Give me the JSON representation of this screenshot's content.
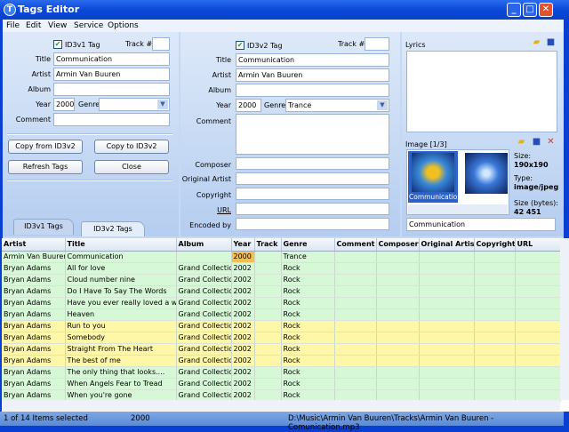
{
  "window": {
    "title": "Tags Editor"
  },
  "menu": [
    "File",
    "Edit",
    "View",
    "Service",
    "Options"
  ],
  "id3v1": {
    "enabled_label": "ID3v1 Tag",
    "track_label": "Track #",
    "track": "",
    "title_label": "Title",
    "title": "Communication",
    "artist_label": "Artist",
    "artist": "Armin Van Buuren",
    "album_label": "Album",
    "album": "",
    "year_label": "Year",
    "year": "2000",
    "genre_label": "Genre",
    "genre": "",
    "comment_label": "Comment",
    "comment": "",
    "buttons": {
      "copy_from": "Copy from ID3v2",
      "copy_to": "Copy to ID3v2",
      "refresh": "Refresh Tags",
      "close": "Close"
    }
  },
  "tabs": [
    {
      "label": "ID3v1 Tags",
      "active": false
    },
    {
      "label": "ID3v2 Tags",
      "active": true
    }
  ],
  "id3v2": {
    "enabled_label": "ID3v2 Tag",
    "track_label": "Track #",
    "track": "",
    "title_label": "Title",
    "title": "Communication",
    "artist_label": "Artist",
    "artist": "Armin Van Buuren",
    "album_label": "Album",
    "album": "",
    "year_label": "Year",
    "year": "2000",
    "genre_label": "Genre",
    "genre": "Trance",
    "comment_label": "Comment",
    "comment": "",
    "composer_label": "Composer",
    "composer": "",
    "original_artist_label": "Original Artist",
    "original_artist": "",
    "copyright_label": "Copyright",
    "copyright": "",
    "url_label": "URL",
    "url": "",
    "encoded_by_label": "Encoded by",
    "encoded_by": ""
  },
  "lyrics": {
    "label": "Lyrics",
    "text": ""
  },
  "image": {
    "label": "Image [1/3]",
    "thumb1_caption": "Communication",
    "size_label": "Size:",
    "size": "190x190",
    "type_label": "Type:",
    "type": "image/jpeg",
    "bytes_label": "Size (bytes):",
    "bytes": "42 451",
    "description": "Communication"
  },
  "grid": {
    "columns": [
      "Artist",
      "Title",
      "Album",
      "Year",
      "Track",
      "Genre",
      "Comment",
      "Composer",
      "Original Artist",
      "Copyright",
      "URL"
    ],
    "rows": [
      [
        "Armin Van Buuren",
        "Communication",
        "",
        "2000",
        "",
        "Trance",
        "g"
      ],
      [
        "Bryan Adams",
        "All for love",
        "Grand Collection",
        "2002",
        "",
        "Rock",
        "g"
      ],
      [
        "Bryan Adams",
        "Cloud number nine",
        "Grand Collection",
        "2002",
        "",
        "Rock",
        "g"
      ],
      [
        "Bryan Adams",
        "Do I Have To Say The Words",
        "Grand Collection",
        "2002",
        "",
        "Rock",
        "g"
      ],
      [
        "Bryan Adams",
        "Have you ever really loved a w",
        "Grand Collection",
        "2002",
        "",
        "Rock",
        "g"
      ],
      [
        "Bryan Adams",
        "Heaven",
        "Grand Collection",
        "2002",
        "",
        "Rock",
        "g"
      ],
      [
        "Bryan Adams",
        "Run to you",
        "Grand Collection",
        "2002",
        "",
        "Rock",
        "y"
      ],
      [
        "Bryan Adams",
        "Somebody",
        "Grand Collection",
        "2002",
        "",
        "Rock",
        "y"
      ],
      [
        "Bryan Adams",
        "Straight From The Heart",
        "Grand Collection",
        "2002",
        "",
        "Rock",
        "y"
      ],
      [
        "Bryan Adams",
        "The best of me",
        "Grand Collection",
        "2002",
        "",
        "Rock",
        "y"
      ],
      [
        "Bryan Adams",
        "The  only thing that looks....",
        "Grand Collection",
        "2002",
        "",
        "Rock",
        "g"
      ],
      [
        "Bryan Adams",
        "When Angels Fear to Tread",
        "Grand Collection",
        "2002",
        "",
        "Rock",
        "g"
      ],
      [
        "Bryan Adams",
        "When you're gone",
        "Grand Collection",
        "2002",
        "",
        "Rock",
        "g"
      ]
    ]
  },
  "status": {
    "selection": "1 of 14 Items selected",
    "value": "2000",
    "path": "D:\\Music\\Armin Van Buuren\\Tracks\\Armin Van Buuren - Comunication.mp3"
  },
  "colors": {
    "modified_row": "#fff7a8",
    "normal_row": "#d6f8d6",
    "selected_cell": "#f5bf4e"
  }
}
